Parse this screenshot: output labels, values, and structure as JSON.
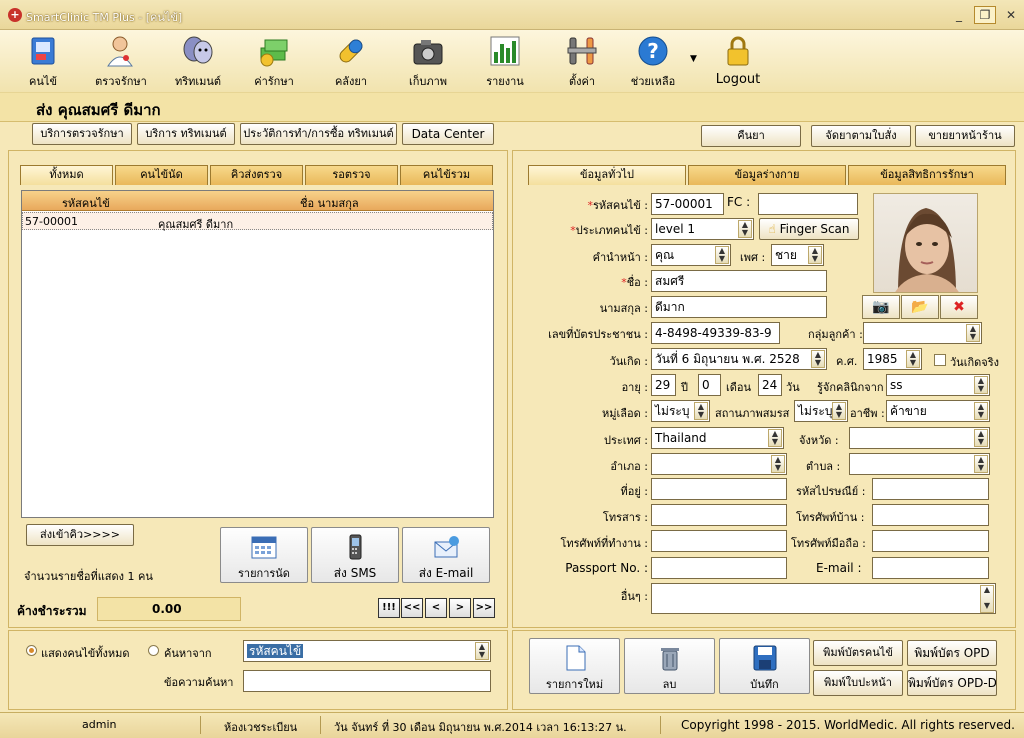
{
  "window": {
    "title": "SmartClinic TM Plus - [คนไข้]"
  },
  "toolbar": {
    "items": [
      {
        "label": "คนไข้",
        "icon": "patient-book-icon"
      },
      {
        "label": "ตรวจรักษา",
        "icon": "doctor-icon"
      },
      {
        "label": "ทริทเมนต์",
        "icon": "treatment-mask-icon"
      },
      {
        "label": "ค่ารักษา",
        "icon": "money-icon"
      },
      {
        "label": "คลังยา",
        "icon": "pill-icon"
      },
      {
        "label": "เก็บภาพ",
        "icon": "camera-icon"
      },
      {
        "label": "รายงาน",
        "icon": "report-chart-icon"
      },
      {
        "label": "ตั้งค่า",
        "icon": "settings-tools-icon"
      },
      {
        "label": "ช่วยเหลือ",
        "icon": "help-icon"
      },
      {
        "label": "Logout",
        "icon": "lock-icon"
      }
    ]
  },
  "patient": {
    "header": "ส่ง  คุณสมศรี ดีมาก"
  },
  "actions_left": [
    "บริการตรวจรักษา",
    "บริการ ทริทเมนต์",
    "ประวัติการทำ/การซื้อ ทริทเมนต์",
    "Data Center"
  ],
  "actions_right": [
    "คืนยา",
    "จัดยาตามใบสั่ง",
    "ขายยาหน้าร้าน"
  ],
  "left_tabs": [
    "ทั้งหมด",
    "คนไข้นัด",
    "คิวส่งตรวจ",
    "รอตรวจ",
    "คนไข้รวม"
  ],
  "grid": {
    "columns": [
      "รหัสคนไข้",
      "ชื่อ นามสกุล"
    ],
    "rows": [
      {
        "id": "57-00001",
        "name": "คุณสมศรี ดีมาก"
      }
    ]
  },
  "queue_button": "ส่งเข้าคิว>>>>",
  "count_text": "จำนวนรายชื่อที่แสดง 1 คน",
  "left_buttons": [
    {
      "label": "รายการนัด",
      "icon": "calendar-icon"
    },
    {
      "label": "ส่ง SMS",
      "icon": "mobile-phone-icon"
    },
    {
      "label": "ส่ง E-mail",
      "icon": "email-icon"
    }
  ],
  "balance": {
    "label": "ค้างชำระรวม",
    "value": "0.00"
  },
  "nav": [
    "!!!",
    "<<",
    "<",
    ">",
    ">>"
  ],
  "search": {
    "radio_all": "แสดงคนไข้ทั้งหมด",
    "radio_search": "ค้นหาจาก",
    "search_by": "รหัสคนไข้",
    "keyword_label": "ข้อความค้นหา",
    "keyword_value": ""
  },
  "right_tabs": [
    "ข้อมูลทั่วไป",
    "ข้อมูลร่างกาย",
    "ข้อมูลสิทธิการรักษา"
  ],
  "form": {
    "patient_id_label": "รหัสคนไข้ :",
    "patient_id": "57-00001",
    "fc_label": "FC :",
    "fc": "",
    "patient_type_label": "ประเภทคนไข้ :",
    "patient_type": "level 1",
    "finger_scan": "Finger Scan",
    "prefix_label": "คำนำหน้า :",
    "prefix": "คุณ",
    "sex_label": "เพศ :",
    "sex": "ชาย",
    "first_name_label": "ชื่อ :",
    "first_name": "สมศรี",
    "last_name_label": "นามสกุล :",
    "last_name": "ดีมาก",
    "citizen_id_label": "เลขที่บัตรประชาชน :",
    "citizen_id": "4-8498-49339-83-9",
    "customer_group_label": "กลุ่มลูกค้า :",
    "customer_group": "",
    "birth_label": "วันเกิด :",
    "birth": "วันที่  6  มิถุนายน  พ.ศ.  2528",
    "ad_label": "ค.ศ.",
    "ad_year": "1985",
    "real_birth": "วันเกิดจริง",
    "age_label": "อายุ :",
    "age_years": "29",
    "years_unit": "ปี",
    "age_months": "0",
    "months_unit": "เดือน",
    "age_days": "24",
    "days_unit": "วัน",
    "referral_label": "รู้จักคลินิกจาก :",
    "referral": "ss",
    "blood_label": "หมู่เลือด :",
    "blood": "ไม่ระบุ",
    "marital_label": "สถานภาพสมรส :",
    "marital": "ไม่ระบุ",
    "career_label": "อาชีพ :",
    "career": "ค้าขาย",
    "country_label": "ประเทศ :",
    "country": "Thailand",
    "province_label": "จังหวัด :",
    "province": "",
    "district_label": "อำเภอ :",
    "district": "",
    "subdistrict_label": "ตำบล :",
    "subdistrict": "",
    "address_label": "ที่อยู่ :",
    "address": "",
    "postcode_label": "รหัสไปรษณีย์ :",
    "postcode": "",
    "fax_label": "โทรสาร :",
    "fax": "",
    "home_phone_label": "โทรศัพท์บ้าน :",
    "home_phone": "",
    "work_phone_label": "โทรศัพท์ที่ทำงาน :",
    "work_phone": "",
    "mobile_label": "โทรศัพท์มือถือ :",
    "mobile": "",
    "passport_label": "Passport No. :",
    "passport": "",
    "email_label": "E-mail :",
    "email": "",
    "other_label": "อื่นๆ :",
    "other": ""
  },
  "bottom_buttons": [
    {
      "label": "รายการใหม่",
      "icon": "new-document-icon"
    },
    {
      "label": "ลบ",
      "icon": "trash-icon"
    },
    {
      "label": "บันทึก",
      "icon": "save-disk-icon"
    }
  ],
  "print_buttons": [
    "พิมพ์บัตรคนไข้",
    "พิมพ์บัตร OPD",
    "พิมพ์ใบปะหน้า",
    "พิมพ์บัตร OPD-D"
  ],
  "status": {
    "user": "admin",
    "room": "ห้องเวชระเบียน",
    "datetime": "วัน จันทร์ ที่ 30 เดือน มิถุนายน พ.ศ.2014 เวลา 16:13:27 น.",
    "copyright": "Copyright 1998 - 2015. WorldMedic. All rights reserved."
  }
}
